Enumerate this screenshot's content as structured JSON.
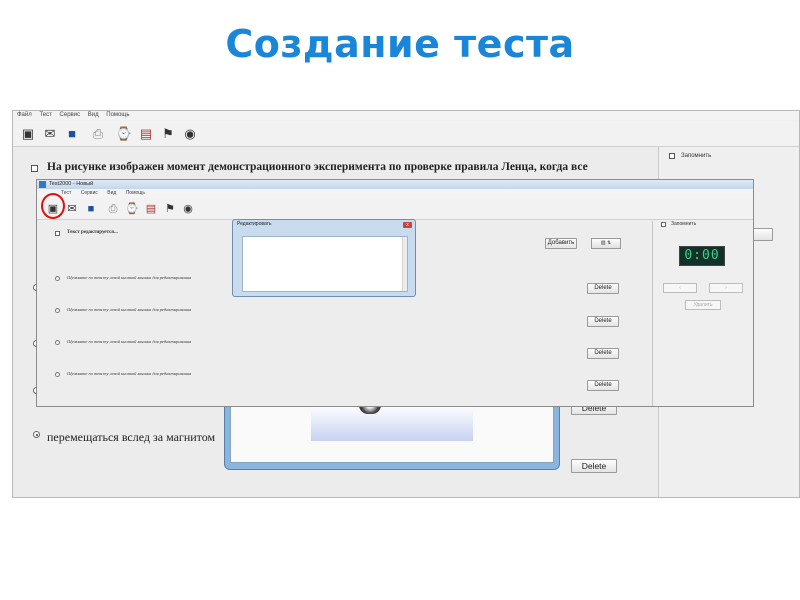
{
  "slide": {
    "title": "Создание теста"
  },
  "back_window": {
    "menu": [
      "Файл",
      "Тест",
      "Сервис",
      "Вид",
      "Помощь"
    ],
    "question_text": "На рисунке изображен момент демонстрационного эксперимента по проверке правила Ленца, когда все",
    "remember_label": "Запомнить",
    "answer_text": "перемещаться вслед за магнитом",
    "delete_labels": [
      "Delete",
      "Delete"
    ]
  },
  "front_window": {
    "title": "Test2000 - Новый",
    "menu": [
      "Тест",
      "Сервис",
      "Вид",
      "Помощь"
    ],
    "question_placeholder": "Текст редактируется...",
    "answer_placeholders": [
      "Щелкните по тексту левой кнопкой мышки для редактирования",
      "Щелкните по тексту левой кнопкой мышки для редактирования",
      "Щелкните по тексту левой кнопкой мышки для редактирования",
      "Щелкните по тексту левой кнопкой мышки для редактирования"
    ],
    "add_label": "Добавить",
    "delete_labels": [
      "Delete",
      "Delete",
      "Delete",
      "Delete"
    ],
    "remember_label": "Запомнить",
    "timer": "0:00",
    "delete_btn_label": "Удалить"
  },
  "editor_dialog": {
    "title": "Редактировать",
    "close": "x"
  },
  "icons": {
    "back_toolbar": [
      "new-test-icon",
      "open-icon",
      "save-icon",
      "print-icon",
      "timer-icon",
      "export-icon",
      "settings-icon",
      "view-icon"
    ],
    "front_toolbar": [
      "new-test-icon",
      "open-icon",
      "save-icon",
      "print-icon",
      "timer-icon",
      "export-icon",
      "settings-icon",
      "view-icon"
    ]
  },
  "colors": {
    "title": "#1a86d9",
    "highlight": "#e01010",
    "timer": "#3ecf8e"
  }
}
